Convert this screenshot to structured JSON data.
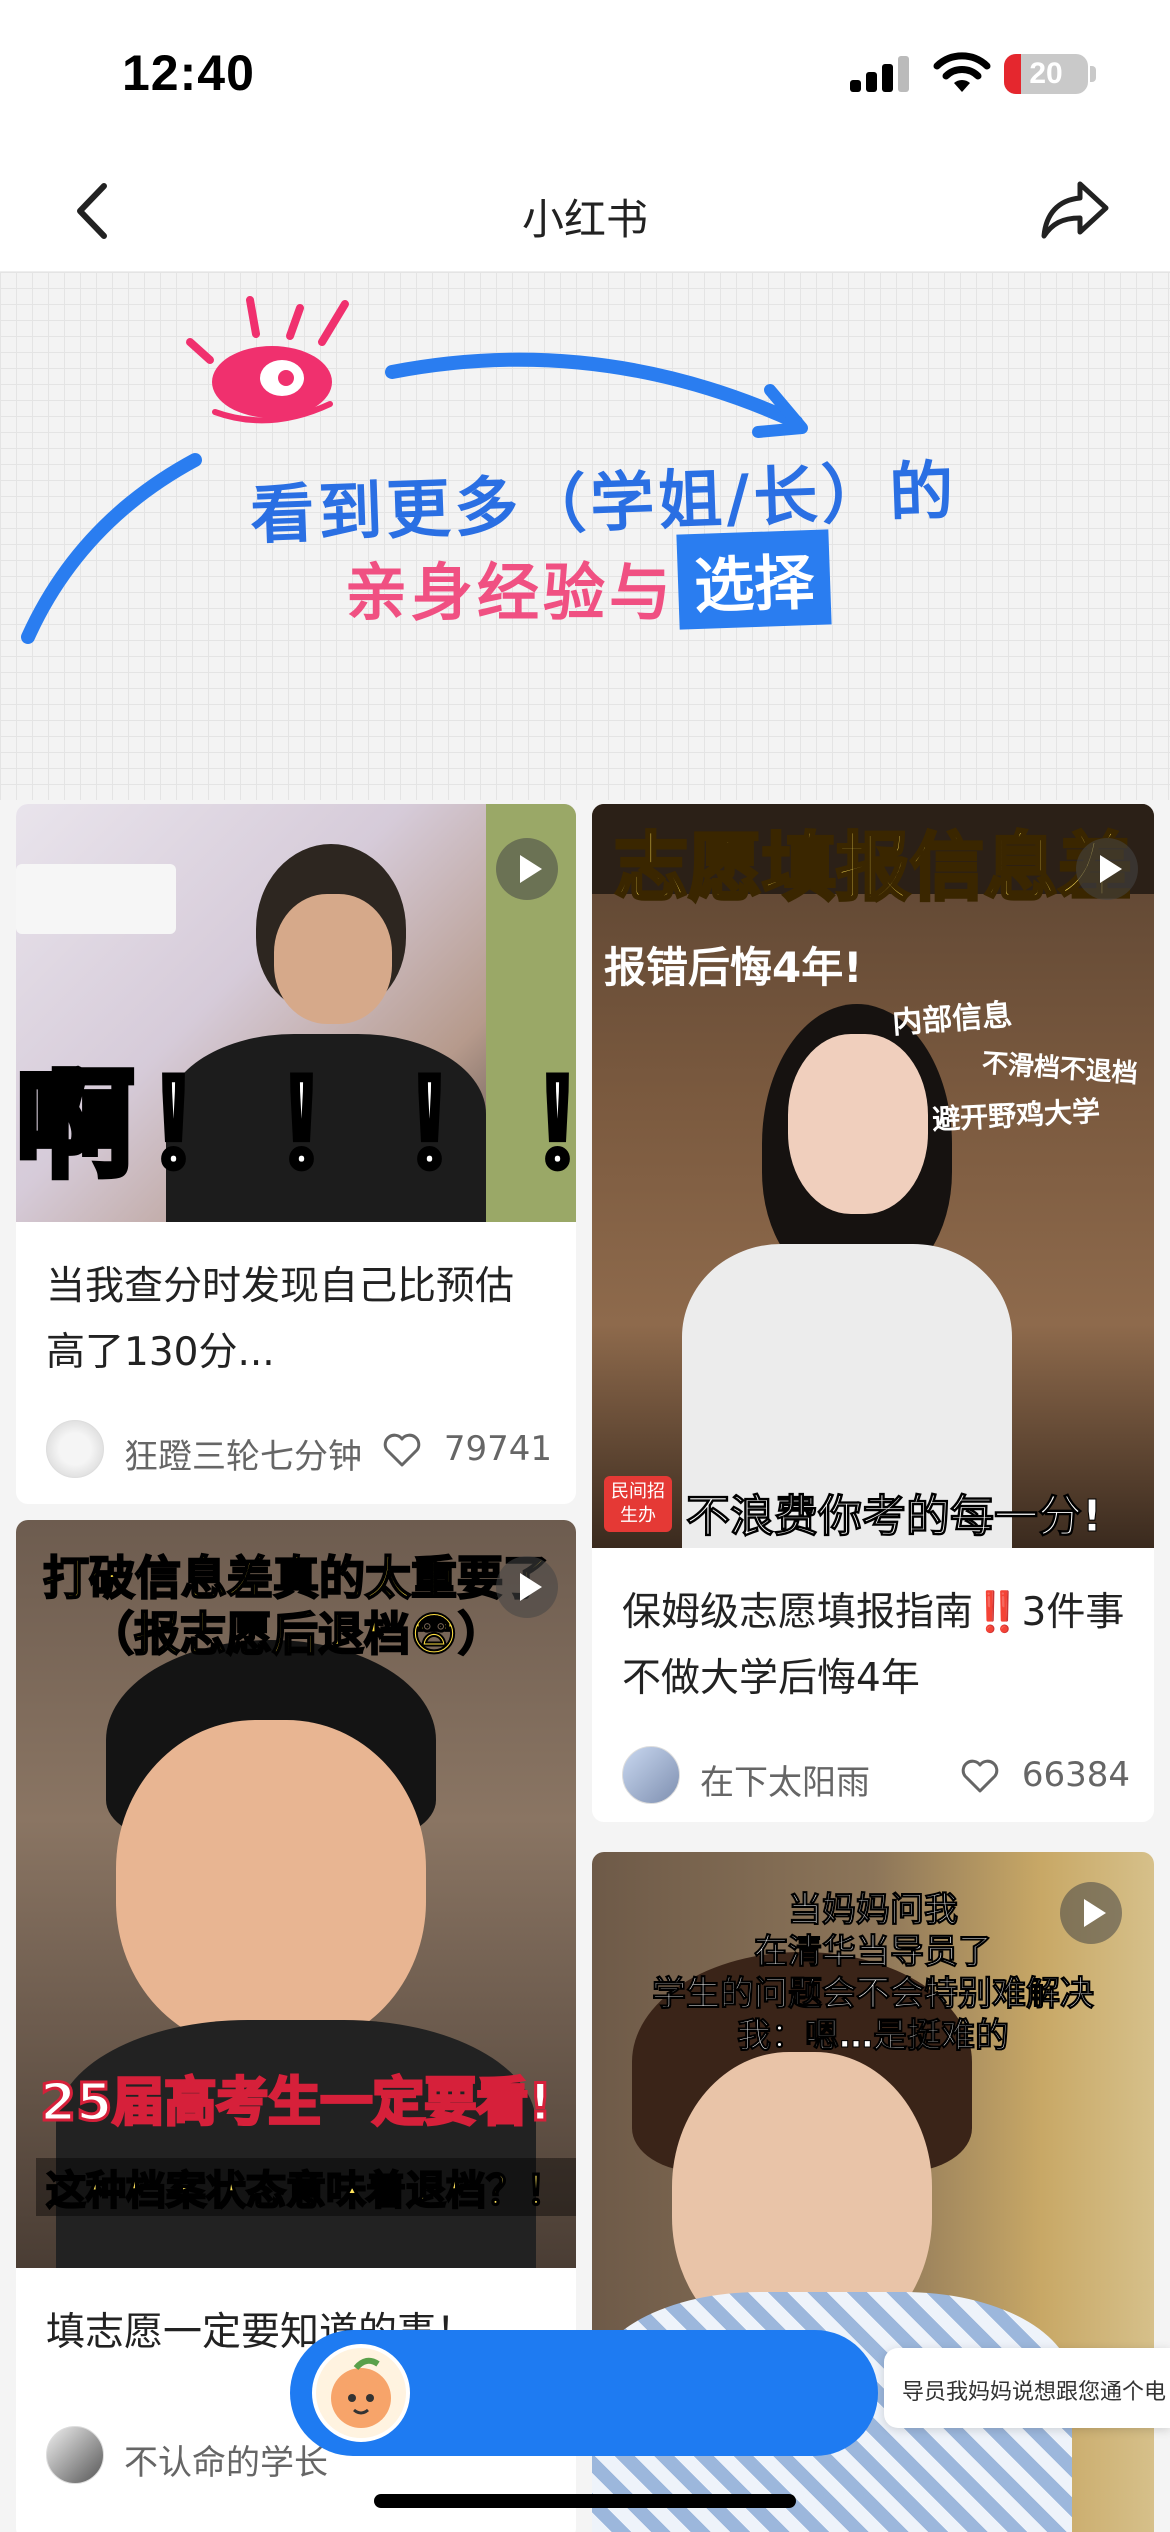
{
  "status_bar": {
    "time": "12:40",
    "battery": "20",
    "battery_level": 0.2
  },
  "nav": {
    "title": "小红书",
    "back_icon": "chevron-left-icon",
    "share_icon": "share-arrow-icon"
  },
  "banner": {
    "line1": "看到更多（学姐/长）的",
    "line2": "亲身经验与",
    "highlight": "选择"
  },
  "feed": {
    "cards": [
      {
        "overlay": "啊！！！！",
        "title": "当我查分时发现自己比预估高了130分...",
        "author": "狂蹬三轮七分钟",
        "likes": "79741",
        "is_video": true
      },
      {
        "overlay_top": "志愿填报信息差",
        "overlay_sub": "报错后悔4年!",
        "overlay_notes": [
          "内部信息",
          "不滑档不退档",
          "避开野鸡大学"
        ],
        "overlay_bottom": "不浪费你考的每一分!",
        "brand_badge": "民间招生办",
        "title": "保姆级志愿填报指南‼️3件事不做大学后悔4年",
        "author": "在下太阳雨",
        "likes": "66384",
        "is_video": true
      },
      {
        "overlay_top": "打破信息差真的太重要了",
        "overlay_top2": "（报志愿后退档😨）",
        "overlay_mid": "25届高考生一定要看!",
        "overlay_bottom": "这种档案状态意味着退档？！",
        "title": "填志愿一定要知道的事！",
        "author": "不认命的学长",
        "is_video": true
      },
      {
        "overlay_lines": [
          "当妈妈问我",
          "在清华当导员了",
          "学生的问题会不会特别难解决",
          "我：嗯…是挺难的"
        ],
        "is_video": true
      }
    ]
  },
  "float_tip": "导员我妈妈说想跟您通个电"
}
